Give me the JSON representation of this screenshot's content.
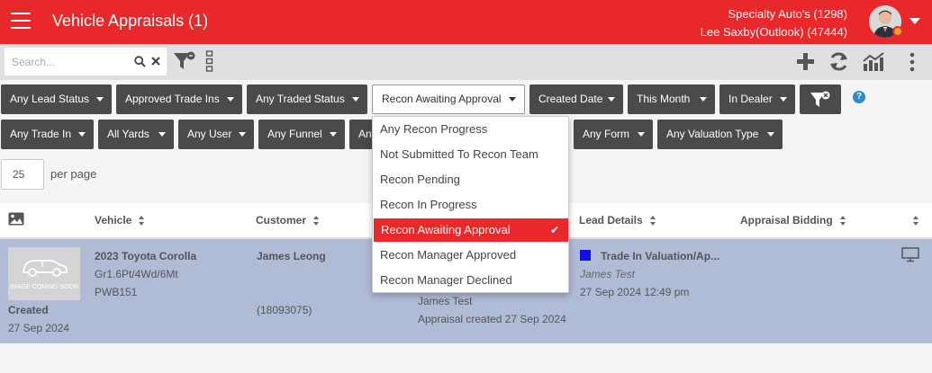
{
  "header": {
    "title": "Vehicle Appraisals (1)",
    "dealer": "Specialty Auto's (1298)",
    "user": "Lee Saxby(Outlook) (47444)"
  },
  "toolbar": {
    "search_placeholder": "Search..."
  },
  "filters": {
    "row1": [
      "Any Lead Status",
      "Approved Trade Ins",
      "Any Traded Status",
      "Recon Awaiting Approval",
      "Created Date",
      "This Month",
      "In Dealer"
    ],
    "row2": [
      "Any Trade In",
      "All Yards",
      "Any User",
      "Any Funnel",
      "Any",
      "Any Form",
      "Any Valuation Type"
    ],
    "help": "?"
  },
  "pagination": {
    "per_page_value": "25",
    "per_page_label": "per page"
  },
  "recon_dropdown": {
    "options": [
      "Any Recon Progress",
      "Not Submitted To Recon Team",
      "Recon Pending",
      "Recon In Progress",
      "Recon Awaiting Approval",
      "Recon Manager Approved",
      "Recon Manager Declined"
    ],
    "selected_index": 4
  },
  "table": {
    "headers": [
      "Vehicle",
      "Customer",
      "Lead Details",
      "Appraisal Bidding"
    ],
    "row": {
      "thumb_text": "IMAGE COMING SOON",
      "created_label": "Created",
      "created_date": "27 Sep 2024",
      "vehicle_name": "2023 Toyota Corolla",
      "vehicle_spec": "Gr1.6Pt/4Wd/6Mt",
      "vehicle_stock": "PWB151",
      "customer_name": "James Leong",
      "customer_id": "(18093075)",
      "appraiser": "James Test",
      "appraisal_created": "Appraisal created 27 Sep 2024",
      "lead_title": "Trade In Valuation/Ap...",
      "lead_user": "James Test",
      "lead_datetime": "27 Sep 2024 12:49 pm"
    }
  },
  "colors": {
    "brand_red": "#e8282a",
    "filter_dark": "#4a4a4a",
    "row_highlight": "#b0bbd6",
    "lead_marker": "#1010e8"
  }
}
